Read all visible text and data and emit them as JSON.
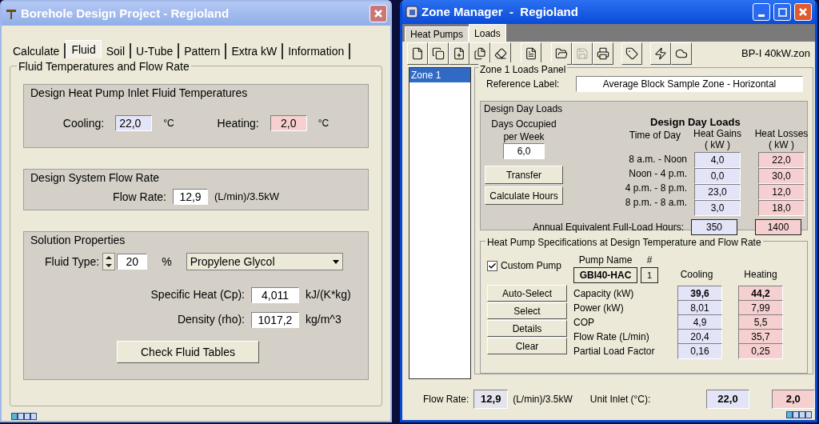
{
  "left_window": {
    "title": "Borehole Design Project - Regioland",
    "tabs": [
      {
        "label": "Calculate",
        "selected": false
      },
      {
        "label": "Fluid",
        "selected": true
      },
      {
        "label": "Soil",
        "selected": false
      },
      {
        "label": "U-Tube",
        "selected": false
      },
      {
        "label": "Pattern",
        "selected": false
      },
      {
        "label": "Extra kW",
        "selected": false
      },
      {
        "label": "Information",
        "selected": false
      }
    ],
    "group_title": "Fluid Temperatures and Flow Rate",
    "temperatures": {
      "title": "Design Heat Pump Inlet Fluid Temperatures",
      "cooling": {
        "label": "Cooling:",
        "value": "22,0",
        "unit": "°C"
      },
      "heating": {
        "label": "Heating:",
        "value": "2,0",
        "unit": "°C"
      }
    },
    "flow": {
      "title": "Design System Flow Rate",
      "label": "Flow Rate:",
      "value": "12,9",
      "unit": "(L/min)/3.5kW"
    },
    "solution": {
      "title": "Solution Properties",
      "fluid_type": {
        "label": "Fluid Type:",
        "value": "20",
        "unit": "%",
        "selection": "Propylene Glycol"
      },
      "properties": [
        {
          "label": "Specific Heat (Cp):",
          "value": "4,011",
          "unit": "kJ/(K*kg)"
        },
        {
          "label": "Density (rho):",
          "value": "1017,2",
          "unit": "kg/m^3"
        }
      ],
      "button": "Check Fluid Tables"
    }
  },
  "right_window": {
    "title": "Zone Manager  -  Regioland",
    "tabs": [
      {
        "label": "Heat Pumps",
        "selected": false
      },
      {
        "label": "Loads",
        "selected": true
      }
    ],
    "toolbar_file": "BP-I 40kW.zon",
    "zones": [
      {
        "label": "Zone 1",
        "selected": true
      }
    ],
    "panel_title": "Zone 1 Loads Panel",
    "reference": {
      "label": "Reference Label:",
      "value": "Average Block Sample Zone - Horizontal"
    },
    "design_day": {
      "title": "Design Day Loads",
      "heading": "Design Day Loads",
      "days_label": "Days Occupied per Week",
      "days_value": "6,0",
      "buttons": [
        "Transfer",
        "Calculate Hours"
      ],
      "time_header": "Time of Day",
      "gains_header": "Heat Gains",
      "gains_unit": "( kW )",
      "losses_header": "Heat Losses",
      "losses_unit": "( kW )",
      "rows": [
        {
          "time": "8 a.m. - Noon",
          "gain": "4,0",
          "loss": "22,0"
        },
        {
          "time": "Noon - 4 p.m.",
          "gain": "0,0",
          "loss": "30,0"
        },
        {
          "time": "4 p.m. - 8 p.m.",
          "gain": "23,0",
          "loss": "12,0"
        },
        {
          "time": "8 p.m. - 8 a.m.",
          "gain": "3,0",
          "loss": "18,0"
        }
      ],
      "annual": {
        "label": "Annual Equivalent Full-Load Hours:",
        "gain": "350",
        "loss": "1400"
      }
    },
    "specs": {
      "title": "Heat Pump Specifications at Design Temperature and Flow Rate",
      "custom_pump": {
        "label": "Custom Pump",
        "checked": true
      },
      "pump_name_header": "Pump Name",
      "number_header": "#",
      "pump_name": "GBI40-HAC",
      "number": "1",
      "cooling_header": "Cooling",
      "heating_header": "Heating",
      "buttons": [
        "Auto-Select",
        "Select",
        "Details",
        "Clear"
      ],
      "rows": [
        {
          "label": "Capacity (kW)",
          "cooling": "39,6",
          "heating": "44,2",
          "bold": true
        },
        {
          "label": "Power (kW)",
          "cooling": "8,01",
          "heating": "7,99",
          "bold": false
        },
        {
          "label": "COP",
          "cooling": "4,9",
          "heating": "5,5",
          "bold": false
        },
        {
          "label": "Flow Rate (L/min)",
          "cooling": "20,4",
          "heating": "35,7",
          "bold": false
        },
        {
          "label": "Partial Load Factor",
          "cooling": "0,16",
          "heating": "0,25",
          "bold": false
        }
      ]
    },
    "footer": {
      "flow_label": "Flow Rate:",
      "flow_value": "12,9",
      "flow_unit": "(L/min)/3.5kW",
      "inlet_label": "Unit Inlet (°C):",
      "cooling": "22,0",
      "heating": "2,0"
    }
  }
}
